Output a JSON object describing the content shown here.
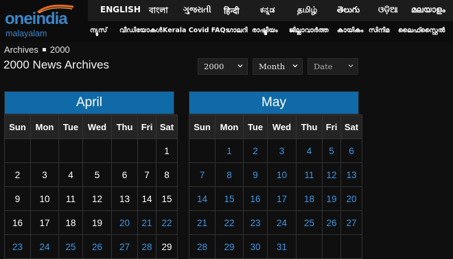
{
  "brand": {
    "logo_main": "oneindia",
    "logo_sub": "malayalam"
  },
  "languages": [
    "ENGLISH",
    "বাংলা",
    "ગુજરાતી",
    "हिन्दी",
    "ಕನ್ನಡ",
    "தமிழ்",
    "తెలుగు",
    "ଓଡ଼ିଆ",
    "മലയാളം"
  ],
  "nav": [
    "ന്യൂസ്",
    "വീഡിയോകൾ",
    "Kerala Covid FAQs",
    "ഗാലറി",
    "രാഷ്ട്രീയം",
    "ജില്ലാവാർത്ത",
    "കായികം",
    "സിനിമ",
    "ലൈഫ്സ്റ്റൈൽ"
  ],
  "breadcrumb": {
    "home": "Archives",
    "current": "2000"
  },
  "page_title": "2000 News Archives",
  "filters": {
    "year": "2000",
    "month": "Month",
    "date": "Date"
  },
  "colors": {
    "header_blue": "#0f6aa7",
    "link_blue": "#3f97e6",
    "logo_blue": "#3d86c9",
    "swoosh_orange": "#e8672a"
  },
  "weekdays": [
    "Sun",
    "Mon",
    "Tue",
    "Wed",
    "Thu",
    "Fri",
    "Sat"
  ],
  "calendars": [
    {
      "month": "April",
      "weeks": [
        [
          "",
          "",
          "",
          "",
          "",
          "",
          "1"
        ],
        [
          "2",
          "3",
          "4",
          "5",
          "6",
          "7",
          "8"
        ],
        [
          "9",
          "10",
          "11",
          "12",
          "13",
          "14",
          "15"
        ],
        [
          "16",
          "17",
          "18",
          "19",
          "20",
          "21",
          "22"
        ],
        [
          "23",
          "24",
          "25",
          "26",
          "27",
          "28",
          "29"
        ]
      ],
      "linked_days": [
        "20",
        "21",
        "22",
        "23",
        "24",
        "25",
        "26",
        "27",
        "28"
      ]
    },
    {
      "month": "May",
      "weeks": [
        [
          "",
          "1",
          "2",
          "3",
          "4",
          "5",
          "6"
        ],
        [
          "7",
          "8",
          "9",
          "10",
          "11",
          "12",
          "13"
        ],
        [
          "14",
          "15",
          "16",
          "17",
          "18",
          "19",
          "20"
        ],
        [
          "21",
          "22",
          "23",
          "24",
          "25",
          "26",
          "27"
        ],
        [
          "28",
          "29",
          "30",
          "31",
          "",
          "",
          ""
        ]
      ],
      "linked_days": "all"
    }
  ]
}
